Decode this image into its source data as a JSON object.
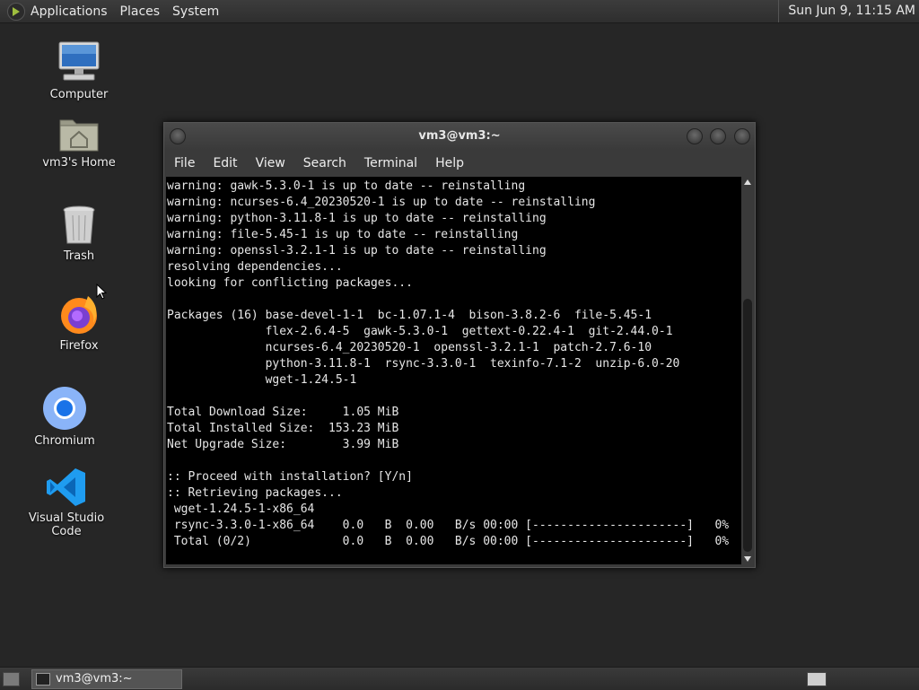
{
  "top_panel": {
    "menus": [
      "Applications",
      "Places",
      "System"
    ],
    "clock": "Sun Jun  9, 11:15 AM"
  },
  "desktop": {
    "icons": [
      {
        "label": "Computer",
        "icon": "computer-icon"
      },
      {
        "label": "vm3's Home",
        "icon": "home-folder-icon"
      },
      {
        "label": "Trash",
        "icon": "trash-icon"
      },
      {
        "label": "Firefox",
        "icon": "firefox-icon"
      },
      {
        "label": "Chromium",
        "icon": "chromium-icon"
      },
      {
        "label": "Visual Studio Code",
        "icon": "vscode-icon"
      }
    ]
  },
  "terminal": {
    "title": "vm3@vm3:~",
    "menu": [
      "File",
      "Edit",
      "View",
      "Search",
      "Terminal",
      "Help"
    ],
    "lines": [
      "warning: gawk-5.3.0-1 is up to date -- reinstalling",
      "warning: ncurses-6.4_20230520-1 is up to date -- reinstalling",
      "warning: python-3.11.8-1 is up to date -- reinstalling",
      "warning: file-5.45-1 is up to date -- reinstalling",
      "warning: openssl-3.2.1-1 is up to date -- reinstalling",
      "resolving dependencies...",
      "looking for conflicting packages...",
      "",
      "Packages (16) base-devel-1-1  bc-1.07.1-4  bison-3.8.2-6  file-5.45-1",
      "              flex-2.6.4-5  gawk-5.3.0-1  gettext-0.22.4-1  git-2.44.0-1",
      "              ncurses-6.4_20230520-1  openssl-3.2.1-1  patch-2.7.6-10",
      "              python-3.11.8-1  rsync-3.3.0-1  texinfo-7.1-2  unzip-6.0-20",
      "              wget-1.24.5-1",
      "",
      "Total Download Size:     1.05 MiB",
      "Total Installed Size:  153.23 MiB",
      "Net Upgrade Size:        3.99 MiB",
      "",
      ":: Proceed with installation? [Y/n]",
      ":: Retrieving packages...",
      " wget-1.24.5-1-x86_64",
      " rsync-3.3.0-1-x86_64    0.0   B  0.00   B/s 00:00 [----------------------]   0%",
      " Total (0/2)             0.0   B  0.00   B/s 00:00 [----------------------]   0%"
    ]
  },
  "taskbar": {
    "items": [
      {
        "label": "vm3@vm3:~",
        "icon": "terminal-icon"
      }
    ]
  },
  "colors": {
    "desktop_bg": "#262626",
    "terminal_bg": "#000000",
    "terminal_fg": "#e6e6e6"
  }
}
